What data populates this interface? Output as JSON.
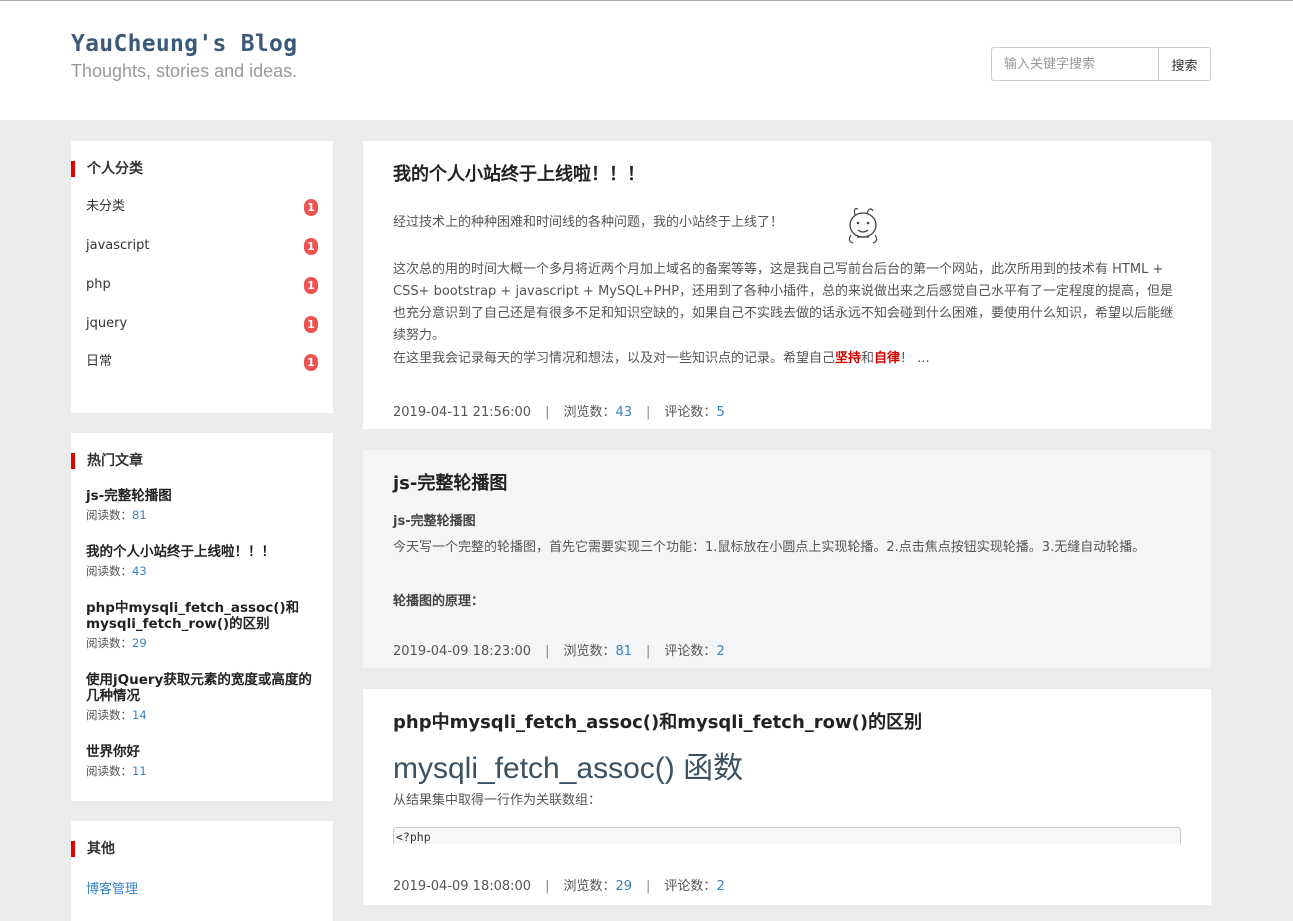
{
  "header": {
    "title": "YauCheung's Blog",
    "subtitle": "Thoughts, stories and ideas.",
    "search_placeholder": "输入关键字搜索",
    "search_button": "搜索"
  },
  "categories": {
    "title": "个人分类",
    "items": [
      {
        "label": "未分类",
        "count": "1"
      },
      {
        "label": "javascript",
        "count": "1"
      },
      {
        "label": "php",
        "count": "1"
      },
      {
        "label": "jquery",
        "count": "1"
      },
      {
        "label": "日常",
        "count": "1"
      }
    ]
  },
  "hot": {
    "title": "热门文章",
    "read_label": "阅读数：",
    "items": [
      {
        "title": "js-完整轮播图",
        "reads": "81"
      },
      {
        "title": "我的个人小站终于上线啦！！！",
        "reads": "43"
      },
      {
        "title": "php中mysqli_fetch_assoc()和mysqli_fetch_row()的区别",
        "reads": "29"
      },
      {
        "title": "使用jQuery获取元素的宽度或高度的几种情况",
        "reads": "14"
      },
      {
        "title": "世界你好",
        "reads": "11"
      }
    ]
  },
  "other": {
    "title": "其他",
    "links": [
      "博客管理"
    ]
  },
  "meta_labels": {
    "views": "浏览数：",
    "comments": "评论数：",
    "sep": "|"
  },
  "posts": [
    {
      "title": "我的个人小站终于上线啦！！！",
      "intro": "经过技术上的种种困难和时间线的各种问题，我的小站终于上线了！",
      "para": "这次总的用的时间大概一个多月将近两个月加上域名的备案等等，这是我自己写前台后台的第一个网站，此次所用到的技术有 HTML + CSS+ bootstrap + javascript + MySQL+PHP，还用到了各种小插件，总的来说做出来之后感觉自己水平有了一定程度的提高，但是也充分意识到了自己还是有很多不足和知识空缺的，如果自己不实践去做的话永远不知会碰到什么困难，要使用什么知识，希望以后能继续努力。",
      "last_pre": "在这里我会记录每天的学习情况和想法，以及对一些知识点的记录。希望自己",
      "last_red1": "坚持",
      "last_mid": "和",
      "last_red2": "自律",
      "last_post": "！ ...",
      "date": "2019-04-11 21:56:00",
      "views": "43",
      "comments": "5"
    },
    {
      "title": "js-完整轮播图",
      "sub": "js-完整轮播图",
      "para": "今天写一个完整的轮播图，首先它需要实现三个功能：1.鼠标放在小圆点上实现轮播。2.点击焦点按钮实现轮播。3.无缝自动轮播。",
      "sub2": "轮播图的原理：",
      "date": "2019-04-09 18:23:00",
      "views": "81",
      "comments": "2"
    },
    {
      "title": "php中mysqli_fetch_assoc()和mysqli_fetch_row()的区别",
      "heading": "mysqli_fetch_assoc() 函数",
      "para": "从结果集中取得一行作为关联数组：",
      "code": "<?php",
      "date": "2019-04-09 18:08:00",
      "views": "29",
      "comments": "2"
    }
  ],
  "icons": {
    "mascot": "doodle-face-icon"
  },
  "colors": {
    "accent": "#e10000",
    "link": "#3a82c4",
    "badge": "#ef5350"
  }
}
